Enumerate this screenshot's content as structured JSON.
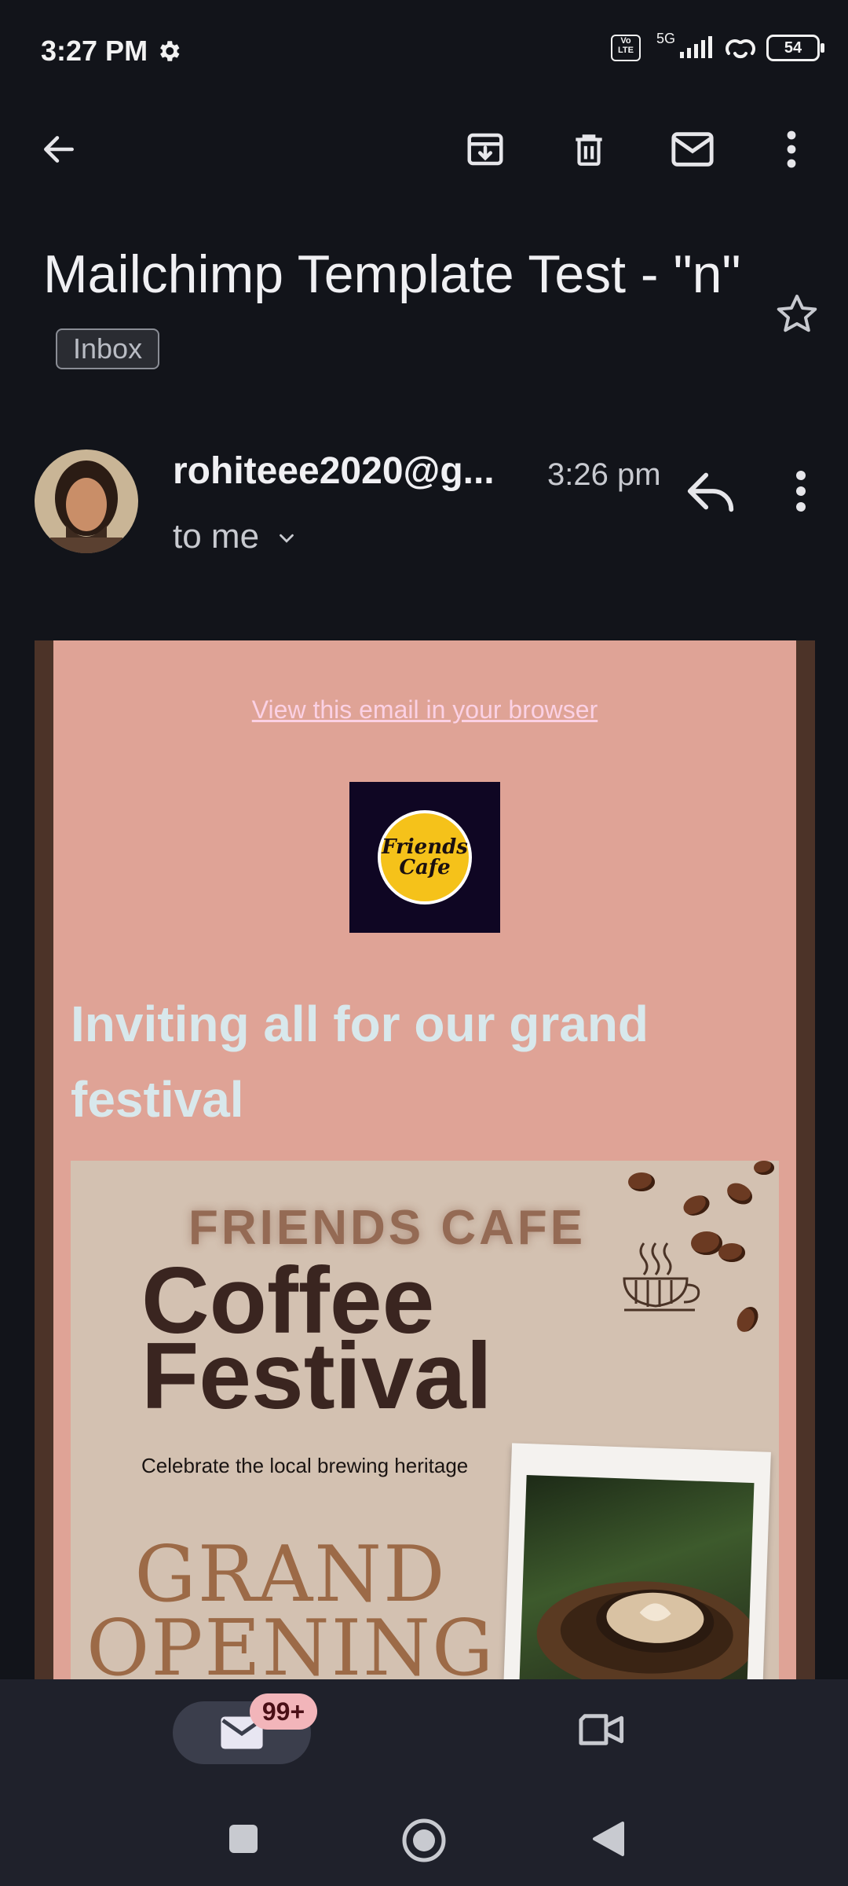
{
  "status_bar": {
    "time": "3:27 PM",
    "volte": "Vo LTE",
    "network": "5G",
    "battery": "54"
  },
  "toolbar": {
    "icons": [
      "back-arrow-icon",
      "archive-icon",
      "delete-icon",
      "mark-unread-icon",
      "more-vert-icon"
    ]
  },
  "email": {
    "subject": "Mailchimp Template Test - \"n\"",
    "label": "Inbox",
    "sender": "rohiteee2020@g...",
    "time": "3:26 pm",
    "recipient": "to me"
  },
  "body": {
    "view_link": "View this email in your browser",
    "logo_text_line1": "Friends",
    "logo_text_line2": "Cafe",
    "headline": "Inviting all for our grand festival",
    "poster": {
      "brand": "FRIENDS CAFE",
      "title_line1": "Coffee",
      "title_line2": "Festival",
      "subtitle": "Celebrate the local brewing heritage",
      "grand_line1": "GRAND",
      "grand_line2": "OPENING"
    }
  },
  "bottom_nav": {
    "mail_badge": "99+"
  },
  "colors": {
    "background": "#12141a",
    "email_bg": "#dfa396",
    "email_border": "#4c3328",
    "headline": "#d8e8ec",
    "link": "#fbd1e4",
    "badge": "#f2b5ba"
  }
}
